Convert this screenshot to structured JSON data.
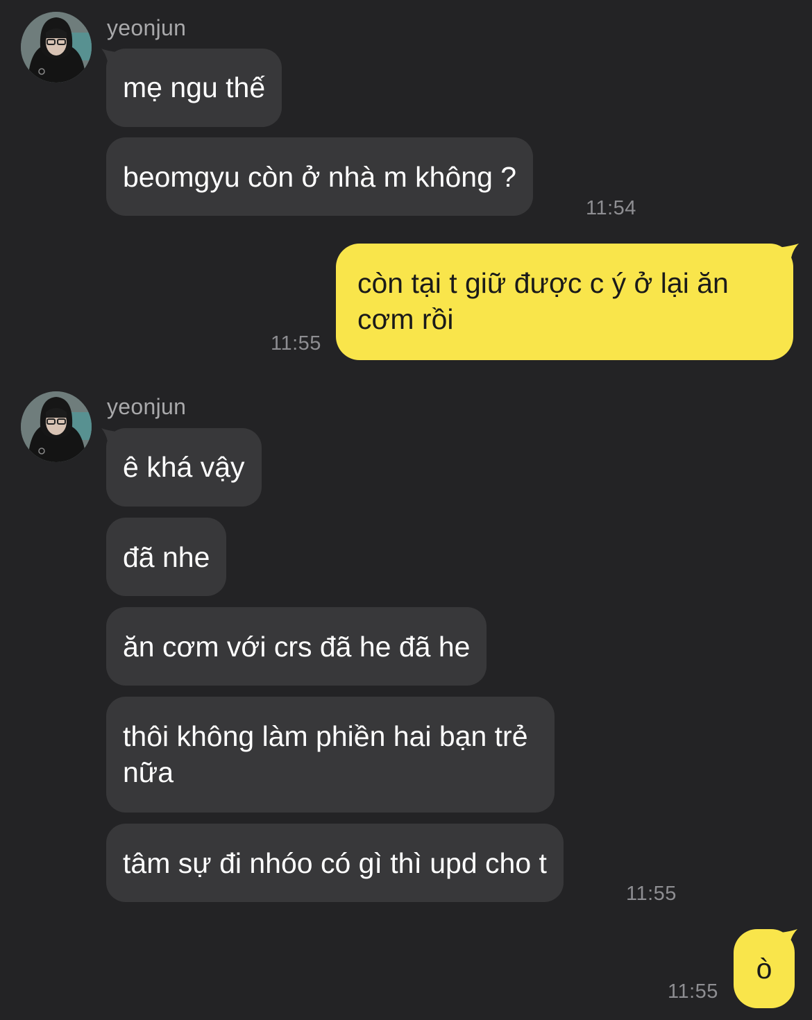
{
  "colors": {
    "background": "#232325",
    "incoming_bubble": "#38383a",
    "outgoing_bubble": "#f9e54b",
    "timestamp": "#8e8e92",
    "sender_name": "#a9a9ab"
  },
  "groups": [
    {
      "sender": "yeonjun",
      "messages": [
        "mẹ ngu thế",
        "beomgyu còn ở nhà m không ?"
      ],
      "time": "11:54"
    },
    {
      "outgoing": true,
      "messages": [
        "còn tại t giữ được c ý ở lại ăn cơm rồi"
      ],
      "time": "11:55"
    },
    {
      "sender": "yeonjun",
      "messages": [
        "ê khá vậy",
        "đã nhe",
        "ăn cơm với crs đã he đã he",
        "thôi không làm phiền hai bạn trẻ nữa",
        "tâm sự đi nhóo có gì thì upd cho t"
      ],
      "time": "11:55"
    },
    {
      "outgoing": true,
      "messages": [
        "ò"
      ],
      "time": "11:55"
    }
  ]
}
